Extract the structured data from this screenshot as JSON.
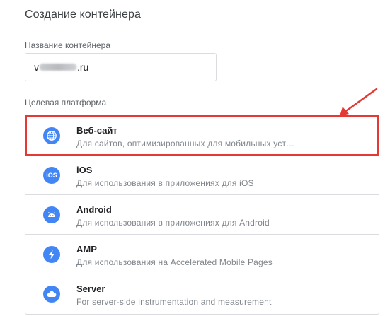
{
  "title": "Создание контейнера",
  "container_name": {
    "label": "Название контейнера",
    "value_prefix": "v",
    "value_suffix": ".ru"
  },
  "platform": {
    "label": "Целевая платформа",
    "items": [
      {
        "title": "Веб-сайт",
        "desc": "Для сайтов, оптимизированных для мобильных уст…",
        "icon": "globe-icon",
        "selected": true
      },
      {
        "title": "iOS",
        "desc": "Для использования в приложениях для iOS",
        "icon": "ios-icon",
        "icon_text": "iOS",
        "selected": false
      },
      {
        "title": "Android",
        "desc": "Для использования в приложениях для Android",
        "icon": "android-icon",
        "selected": false
      },
      {
        "title": "AMP",
        "desc": "Для использования на Accelerated Mobile Pages",
        "icon": "lightning-icon",
        "selected": false
      },
      {
        "title": "Server",
        "desc": "For server-side instrumentation and measurement",
        "icon": "cloud-icon",
        "selected": false
      }
    ]
  },
  "colors": {
    "accent": "#4285f4",
    "highlight": "#e53935",
    "border": "#dadce0",
    "muted_text": "#80868b"
  }
}
